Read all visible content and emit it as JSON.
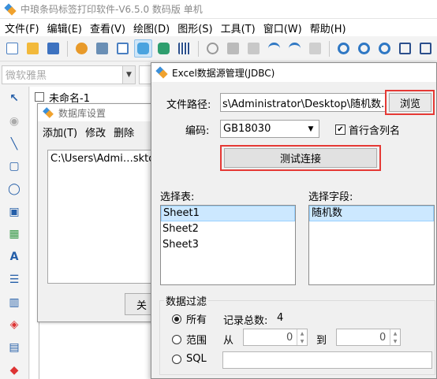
{
  "app": {
    "title": "中琅条码标签打印软件-V6.5.0 数码版 单机"
  },
  "menu": [
    "文件(F)",
    "编辑(E)",
    "查看(V)",
    "绘图(D)",
    "图形(S)",
    "工具(T)",
    "窗口(W)",
    "帮助(H)"
  ],
  "fontbar": {
    "font_name": "微软雅黑"
  },
  "document": {
    "tab_name": "未命名-1"
  },
  "db_dialog": {
    "title": "数据库设置",
    "menu": [
      "添加(T)",
      "修改",
      "删除"
    ],
    "list_items": [
      "C:\\Users\\Admi…sktop"
    ],
    "close_label": "关"
  },
  "excel_dialog": {
    "title": "Excel数据源管理(JDBC)",
    "path_label": "文件路径:",
    "path_value": "s\\Administrator\\Desktop\\随机数.xls",
    "browse_label": "浏览",
    "encoding_label": "编码:",
    "encoding_value": "GB18030",
    "first_row_label": "首行含列名",
    "first_row_checked": true,
    "test_label": "测试连接",
    "table_label": "选择表:",
    "tables": [
      "Sheet1",
      "Sheet2",
      "Sheet3"
    ],
    "field_label": "选择字段:",
    "fields": [
      "随机数"
    ],
    "filter": {
      "title": "数据过滤",
      "all_label": "所有",
      "record_label": "记录总数:",
      "record_count": "4",
      "range_label": "范围",
      "from_label": "从",
      "from_value": "0",
      "to_label": "到",
      "to_value": "0",
      "sql_label": "SQL",
      "selected": "所有"
    }
  },
  "colors": {
    "accent_red": "#e53935",
    "selection": "#cce8ff"
  }
}
